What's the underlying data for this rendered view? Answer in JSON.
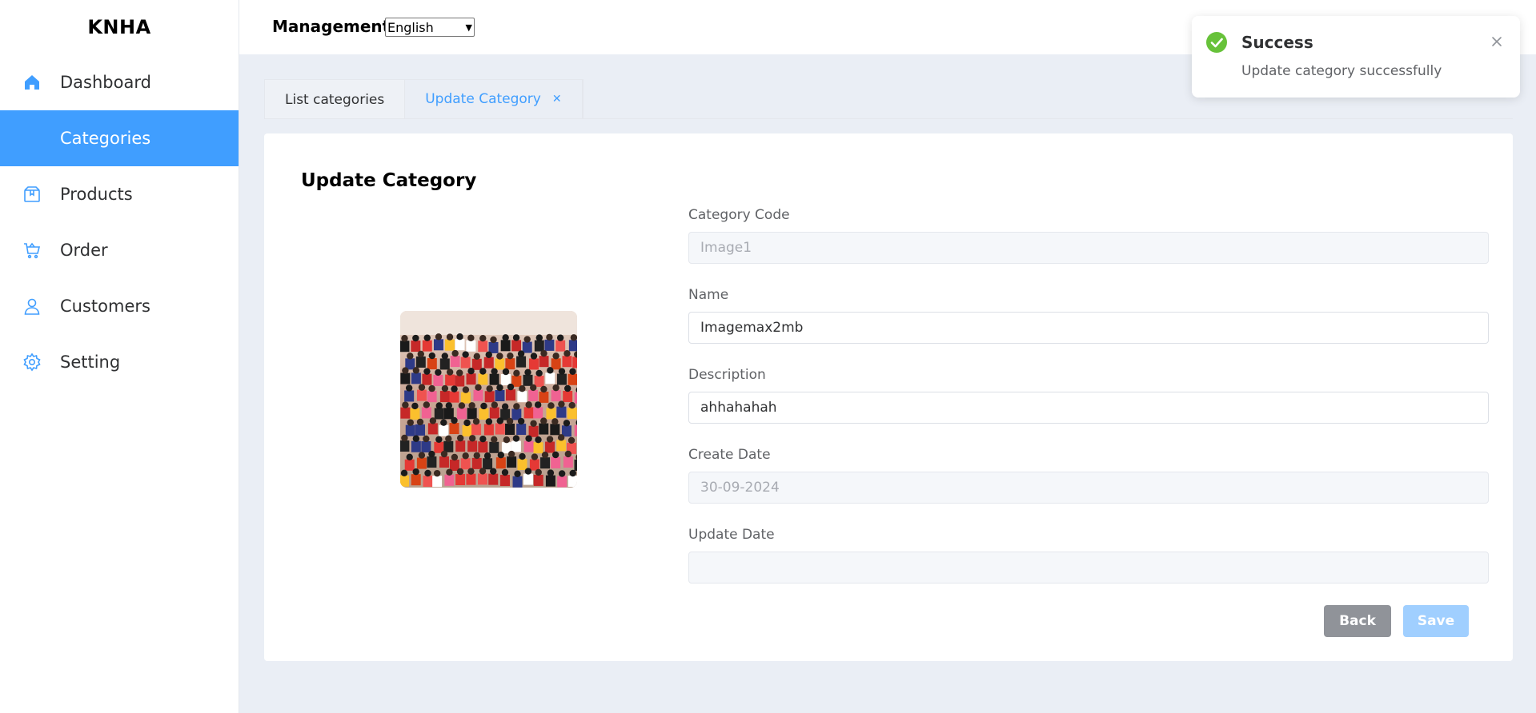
{
  "app": {
    "logo": "KNHA"
  },
  "sidebar": {
    "items": [
      {
        "label": "Dashboard",
        "icon": "home-icon",
        "active": false
      },
      {
        "label": "Categories",
        "icon": "",
        "active": true
      },
      {
        "label": "Products",
        "icon": "box-icon",
        "active": false
      },
      {
        "label": "Order",
        "icon": "cart-icon",
        "active": false
      },
      {
        "label": "Customers",
        "icon": "user-icon",
        "active": false
      },
      {
        "label": "Setting",
        "icon": "gear-icon",
        "active": false
      }
    ]
  },
  "header": {
    "title": "Management",
    "language": "English"
  },
  "tabs": [
    {
      "label": "List categories",
      "active": false
    },
    {
      "label": "Update Category",
      "active": true,
      "closable": true
    }
  ],
  "form": {
    "title": "Update Category",
    "image_alt": "category-image",
    "fields": [
      {
        "label": "Category Code",
        "value": "Image1",
        "disabled": true
      },
      {
        "label": "Name",
        "value": "Imagemax2mb",
        "disabled": false
      },
      {
        "label": "Description",
        "value": "ahhahahah",
        "disabled": false
      },
      {
        "label": "Create Date",
        "value": "30-09-2024",
        "disabled": true
      },
      {
        "label": "Update Date",
        "value": "",
        "disabled": true
      }
    ],
    "back_label": "Back",
    "save_label": "Save"
  },
  "toast": {
    "title": "Success",
    "message": "Update category successfully"
  },
  "colors": {
    "primary": "#409eff",
    "success": "#67c23a",
    "back_button": "#909399",
    "save_button_disabled": "#a0cfff"
  }
}
